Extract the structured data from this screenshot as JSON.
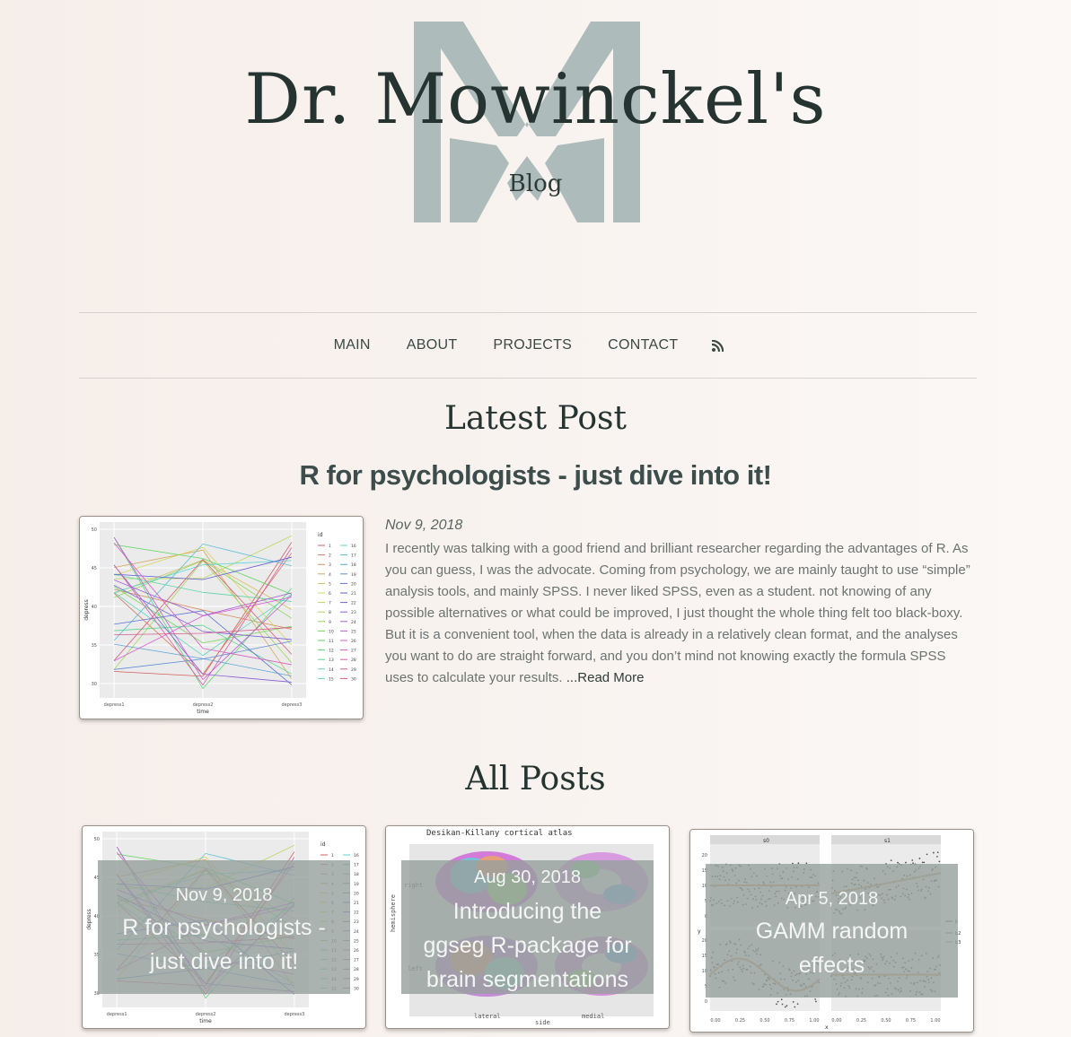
{
  "site": {
    "title": "Dr. Mowinckel's",
    "subtitle": "Blog",
    "logo_letter": "M",
    "colors": {
      "logo": "#adbcba",
      "text": "#253431",
      "background": "#f7f0eb"
    }
  },
  "nav": {
    "items": [
      {
        "label": "MAIN"
      },
      {
        "label": "ABOUT"
      },
      {
        "label": "PROJECTS"
      },
      {
        "label": "CONTACT"
      }
    ],
    "rss_icon": "rss-icon"
  },
  "latest": {
    "heading": "Latest Post",
    "title": "R for psychologists - just dive into it!",
    "date": "Nov 9, 2018",
    "excerpt": "I recently was talking with a good friend and brilliant researcher regarding the advantages of R. As you can guess, I was the advocate. Coming from psychology, we are mainly taught to use “simple” analysis tools, and mainly SPSS. I never liked SPSS, even as a student. not knowing of any possible alternatives or what could be improved, I just thought the whole thing felt too black-boxy. But it is a convenient tool, when the data is already in a relatively clean format, and the analyses you want to do are straight forward, and you don’t mind not knowing exactly the formula SPSS uses to calculate your results.",
    "read_more": " ...Read More",
    "thumb": {
      "ylabel": "depress",
      "xlabel": "time",
      "x_ticks": [
        "depress1",
        "depress2",
        "depress3"
      ],
      "y_ticks": [
        "50",
        "45",
        "40",
        "35",
        "30"
      ],
      "legend_title": "id",
      "legend_col1": [
        "1",
        "2",
        "3",
        "4",
        "5",
        "6",
        "7",
        "8",
        "9",
        "10",
        "11",
        "12",
        "13",
        "14",
        "15"
      ],
      "legend_col2": [
        "16",
        "17",
        "18",
        "19",
        "20",
        "21",
        "22",
        "23",
        "24",
        "25",
        "26",
        "27",
        "28",
        "29",
        "30"
      ]
    }
  },
  "all_posts": {
    "heading": "All Posts",
    "posts": [
      {
        "date": "Nov 9, 2018",
        "title_lines": [
          "R for psychologists -",
          "just dive into it!"
        ]
      },
      {
        "date": "Aug 30, 2018",
        "title_lines": [
          "Introducing the",
          "ggseg R-package for",
          "brain segmentations"
        ],
        "thumb": {
          "title": "Desikan-Killany cortical atlas",
          "ylabel": "hemisphere",
          "row_labels": [
            "right",
            "left"
          ],
          "col_labels": [
            "lateral",
            "medial"
          ],
          "xlabel": "side"
        }
      },
      {
        "date": "Apr 5, 2018",
        "title_lines": [
          "GAMM random",
          "effects"
        ],
        "thumb": {
          "panels": [
            "s0",
            "s1"
          ],
          "ylabel": "y",
          "xlabel": "x",
          "x_ticks": [
            "0.00",
            "0.25",
            "0.50",
            "0.75",
            "1.00"
          ],
          "y_ticks_top": [
            "20",
            "15",
            "10",
            "5",
            "0"
          ],
          "y_ticks_bottom": [
            "20",
            "15",
            "10",
            "5",
            "0"
          ],
          "legend": [
            "b",
            "b2",
            "b3"
          ]
        }
      }
    ]
  }
}
